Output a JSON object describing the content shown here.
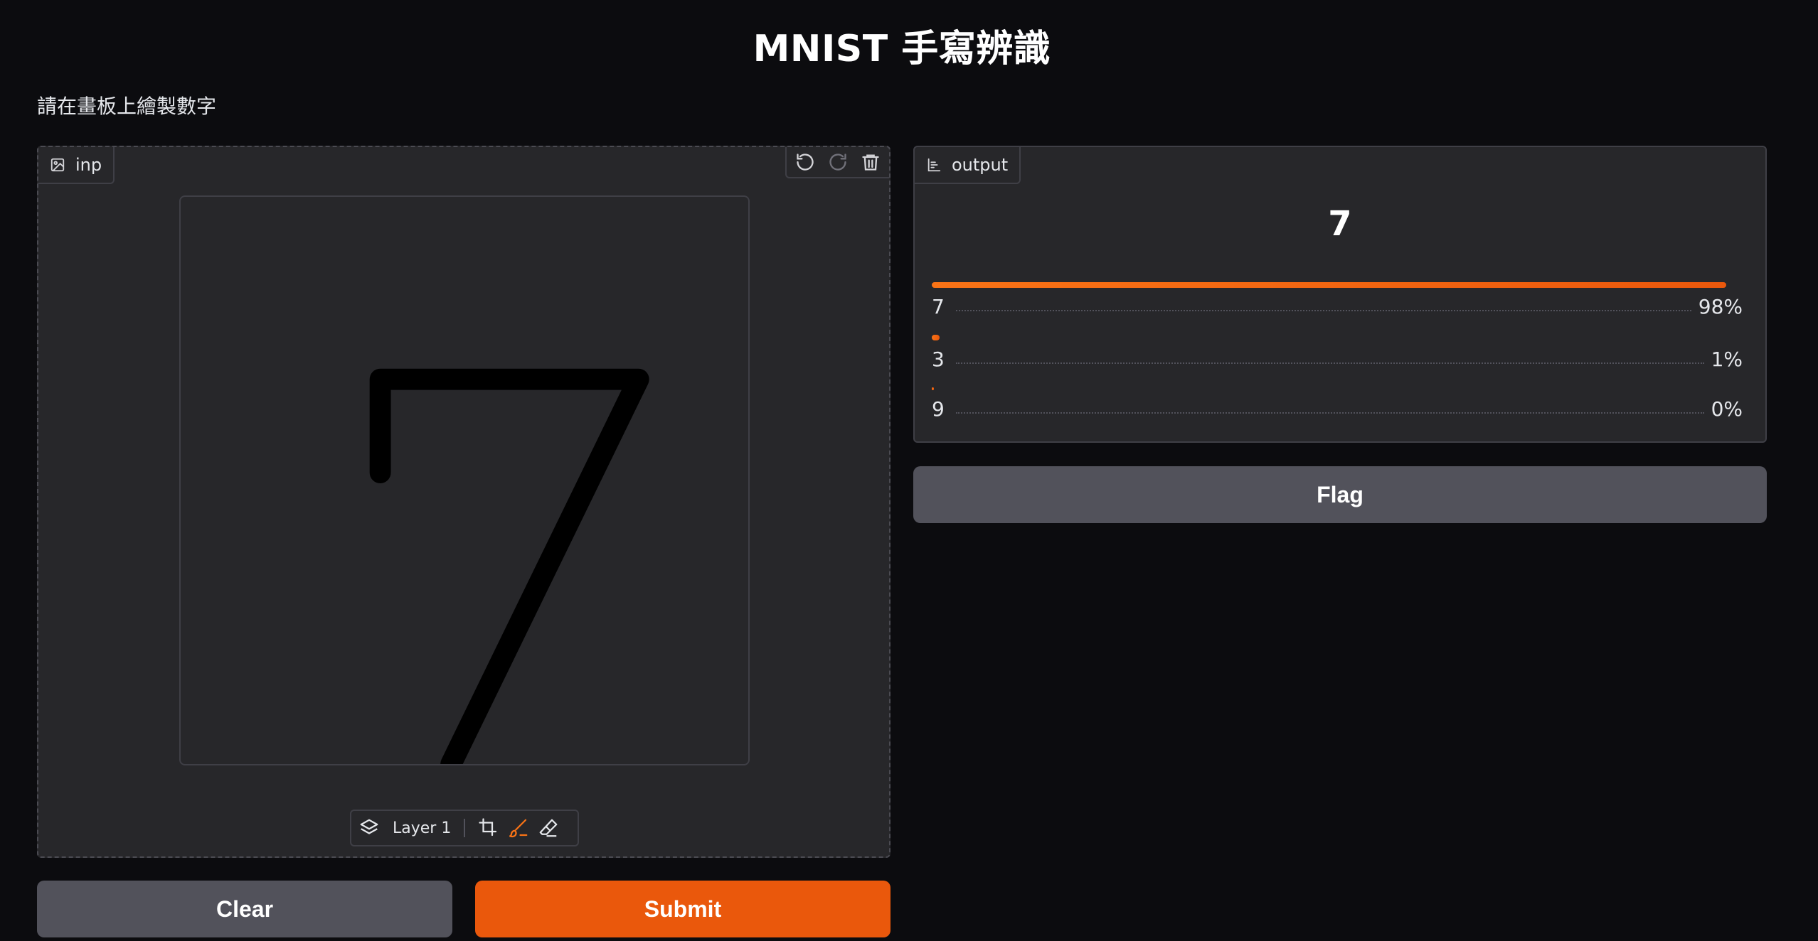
{
  "app": {
    "title": "MNIST 手寫辨識",
    "description": "請在畫板上繪製數字"
  },
  "input": {
    "label": "inp",
    "icon": "image-icon",
    "toolbar": [
      "undo-icon",
      "redo-icon",
      "trash-icon"
    ],
    "layer_label": "Layer 1",
    "layer_tools": [
      "layers-icon",
      "crop-icon",
      "brush-icon",
      "eraser-icon"
    ],
    "active_tool": "brush-icon",
    "stroke_color": "#000000",
    "canvas_bg": "#27272a"
  },
  "output": {
    "label": "output",
    "icon": "bar-chart-icon",
    "prediction": "7",
    "confidences": [
      {
        "label": "7",
        "percent_text": "98%",
        "value": 0.98
      },
      {
        "label": "3",
        "percent_text": "1%",
        "value": 0.01
      },
      {
        "label": "9",
        "percent_text": "0%",
        "value": 0.0
      }
    ]
  },
  "buttons": {
    "clear": "Clear",
    "submit": "Submit",
    "flag": "Flag"
  },
  "colors": {
    "accent": "#ea580c",
    "secondary_button": "#52525b",
    "background": "#0c0c0f",
    "panel": "#27272a"
  }
}
